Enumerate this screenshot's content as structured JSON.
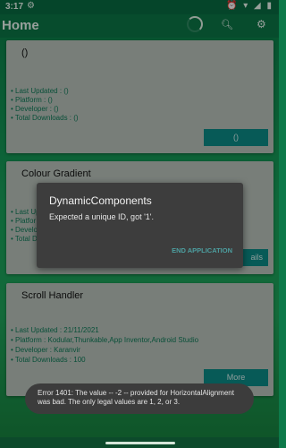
{
  "status": {
    "time": "3:17",
    "left_icon": "gear-icon",
    "right_icons": "⏰ ▾ ◢ ▮"
  },
  "appbar": {
    "title": "Home",
    "search_icon": "search-icon",
    "settings_icon": "gear-icon"
  },
  "cards": [
    {
      "title": "()",
      "last_updated": "• Last Updated : ()",
      "platform": "• Platform : ()",
      "developer": "• Developer : ()",
      "downloads": "• Total Downloads : ()",
      "button": "()"
    },
    {
      "title": "Colour Gradient",
      "last_updated": "• Last Up",
      "platform": "• Platfor",
      "developer": "• Develo",
      "downloads": "• Total D",
      "button": "ails"
    },
    {
      "title": "Scroll Handler",
      "last_updated": "• Last Updated : 21/11/2021",
      "platform": "• Platform : Kodular,Thunkable,App Inventor,Android Studio",
      "developer": "• Developer : Karanvir",
      "downloads": "• Total Downloads : 100",
      "button": "More"
    }
  ],
  "dialog": {
    "title": "DynamicComponents",
    "message": "Expected a unique ID, got '1'.",
    "button": "END APPLICATION"
  },
  "toast": {
    "message": "Error 1401: The value -- -2 -- provided for HorizontalAlignment was bad. The only legal values are 1, 2, or 3."
  },
  "colors": {
    "primary": "#0b7546",
    "accent_button": "#0b8a86",
    "dialog_bg": "#3d3d3d"
  }
}
